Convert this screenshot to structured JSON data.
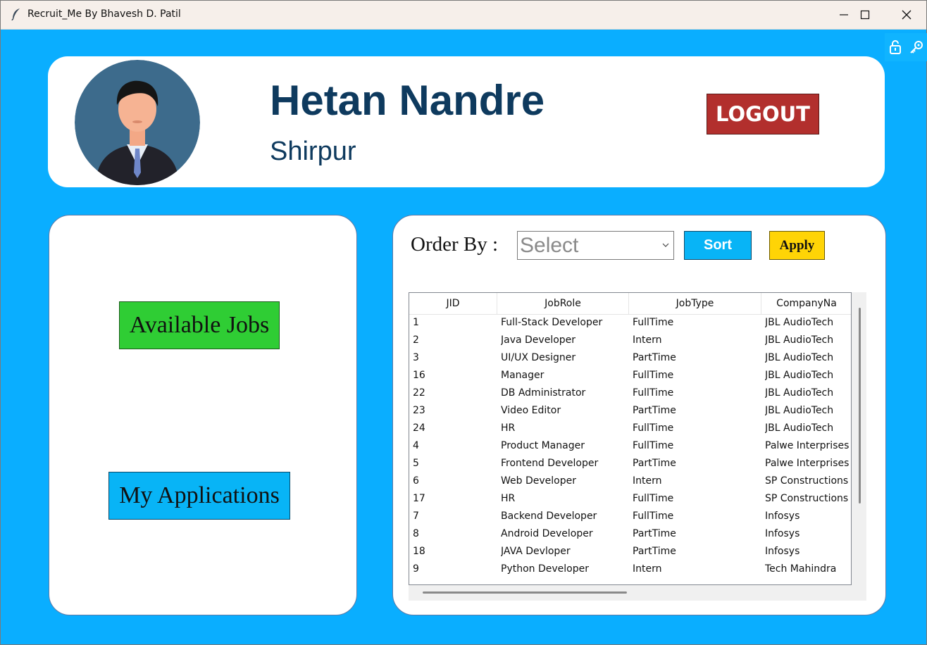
{
  "window": {
    "title": "Recruit_Me By Bhavesh D. Patil",
    "icons": [
      "feather-icon",
      "minimize-icon",
      "maximize-icon",
      "close-icon",
      "lock-icon",
      "key-icon"
    ]
  },
  "colors": {
    "background": "#0aaeff",
    "name_text": "#0e3a5e",
    "logout": "#b22f2d",
    "available_jobs": "#2fcd34",
    "my_applications": "#08b4f6",
    "sort": "#08b4f6",
    "apply": "#ffd406"
  },
  "profile": {
    "name": "Hetan Nandre",
    "city": "Shirpur",
    "avatar_icon": "user-avatar-icon",
    "logout_label": "LOGOUT"
  },
  "menu": {
    "available_jobs_label": "Available Jobs",
    "my_applications_label": "My Applications"
  },
  "controls": {
    "order_by_label": "Order By :",
    "select_value": "Select",
    "sort_label": "Sort",
    "apply_label": "Apply"
  },
  "table": {
    "columns": [
      "JID",
      "JobRole",
      "JobType",
      "CompanyNa"
    ],
    "rows": [
      [
        "1",
        "Full-Stack Developer",
        "FullTime",
        "JBL AudioTech"
      ],
      [
        "2",
        "Java Developer",
        "Intern",
        "JBL AudioTech"
      ],
      [
        "3",
        "UI/UX Designer",
        "PartTime",
        "JBL AudioTech"
      ],
      [
        "16",
        "Manager",
        "FullTime",
        "JBL AudioTech"
      ],
      [
        "22",
        "DB Administrator",
        "FullTime",
        "JBL AudioTech"
      ],
      [
        "23",
        "Video Editor",
        "PartTime",
        "JBL AudioTech"
      ],
      [
        "24",
        "HR",
        "FullTime",
        "JBL AudioTech"
      ],
      [
        "4",
        "Product Manager",
        "FullTime",
        "Palwe Interprises"
      ],
      [
        "5",
        "Frontend Developer",
        "PartTime",
        "Palwe Interprises"
      ],
      [
        "6",
        "Web Developer",
        "Intern",
        "SP Constructions"
      ],
      [
        "17",
        "HR",
        "FullTime",
        "SP Constructions"
      ],
      [
        "7",
        "Backend Developer",
        "FullTime",
        "Infosys"
      ],
      [
        "8",
        "Android Developer",
        "PartTime",
        "Infosys"
      ],
      [
        "18",
        "JAVA Devloper",
        "PartTime",
        "Infosys"
      ],
      [
        "9",
        "Python Developer",
        "Intern",
        "Tech Mahindra"
      ]
    ]
  }
}
